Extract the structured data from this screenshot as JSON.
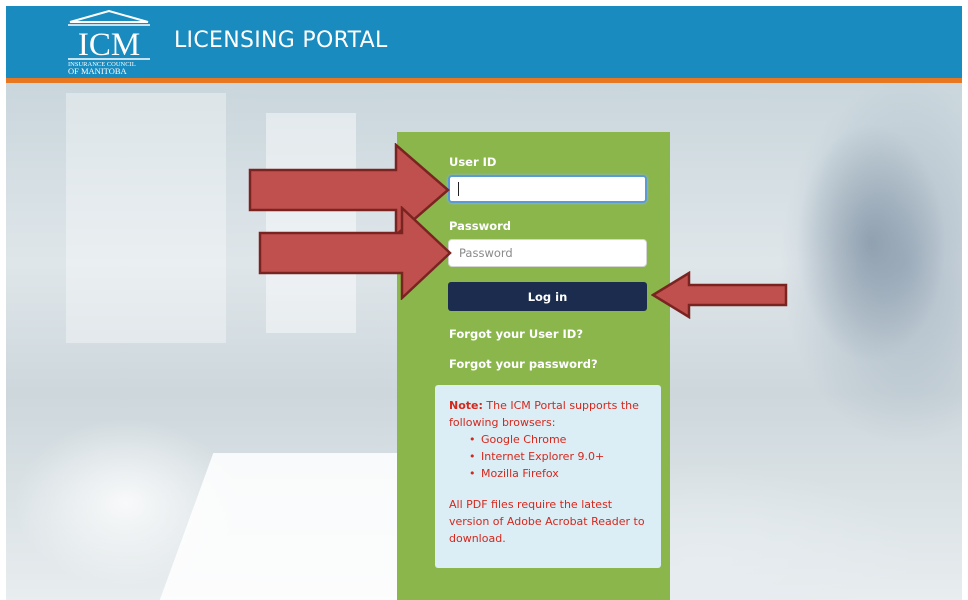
{
  "header": {
    "logo_acronym": "ICM",
    "logo_line1": "INSURANCE COUNCIL",
    "logo_line2": "OF MANITOBA",
    "title": "LICENSING PORTAL",
    "colors": {
      "bar": "#1a8bbf",
      "stripe": "#e87722"
    }
  },
  "login": {
    "user_id_label": "User ID",
    "user_id_value": "",
    "password_label": "Password",
    "password_placeholder": "Password",
    "login_button": "Log in",
    "forgot_user_id": "Forgot your User ID?",
    "forgot_password": "Forgot your password?",
    "colors": {
      "panel": "#8ab64b",
      "button": "#1b2c4e"
    }
  },
  "note": {
    "prefix": "Note:",
    "intro": " The ICM Portal supports the following browsers:",
    "browsers": [
      "Google Chrome",
      "Internet Explorer 9.0+",
      "Mozilla Firefox"
    ],
    "pdf_notice": "All PDF files require the latest version of Adobe Acrobat Reader to download.",
    "colors": {
      "background": "#dbedf5",
      "text": "#d4281d"
    }
  },
  "annotations": {
    "arrow_color": "#c0504d",
    "targets": [
      "user-id-input",
      "password-input",
      "login-button"
    ]
  }
}
